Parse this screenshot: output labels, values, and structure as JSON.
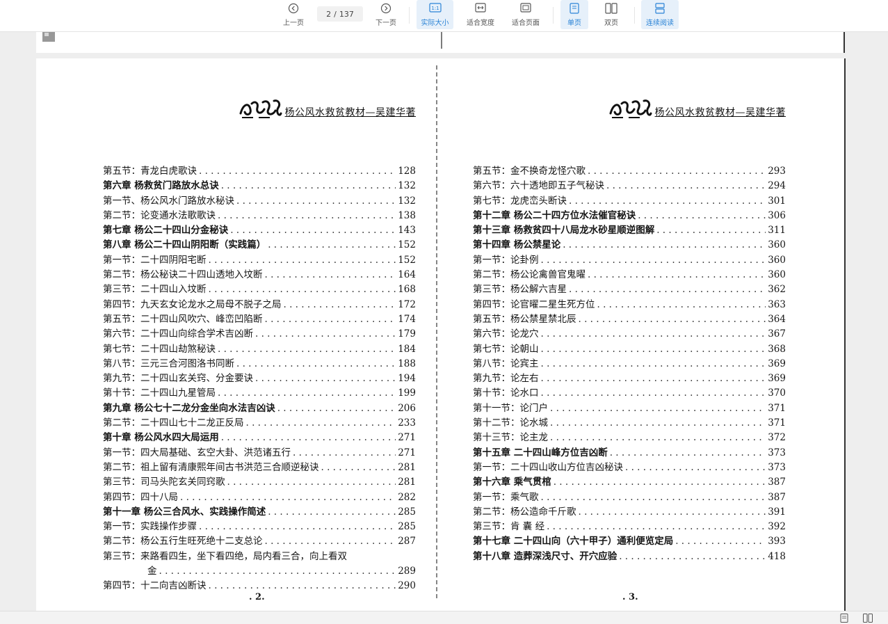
{
  "toolbar": {
    "prev_label": "上一页",
    "next_label": "下一页",
    "current_page": "2",
    "page_separator": "/",
    "total_pages": "137",
    "actual_size_label": "实际大小",
    "fit_width_label": "适合宽度",
    "fit_page_label": "适合页面",
    "single_page_label": "单页",
    "double_page_label": "双页",
    "continuous_label": "连续阅读",
    "accent_color": "#2a83d6",
    "active_bg": "#e6f0fa"
  },
  "left_page": {
    "header_title": "杨公风水救贫教材—吴建华著",
    "page_number": ". 2.",
    "entries": [
      {
        "title": "第五节：青龙白虎歌诀",
        "page": "128",
        "chapter": false
      },
      {
        "title": "第六章  杨救贫门路放水总诀",
        "page": "132",
        "chapter": true
      },
      {
        "title": "第一节、杨公风水门路放水秘诀",
        "page": "132",
        "chapter": false
      },
      {
        "title": "第二节：论变通水法歌歌诀",
        "page": "138",
        "chapter": false
      },
      {
        "title": "第七章  杨公二十四山分金秘诀",
        "page": "143",
        "chapter": true
      },
      {
        "title": "第八章  杨公二十四山阴阳断（实践篇）",
        "page": "152",
        "chapter": true
      },
      {
        "title": "第一节：二十四阴阳宅断",
        "page": "152",
        "chapter": false
      },
      {
        "title": "第二节：杨公秘诀二十四山透地入坟断",
        "page": "164",
        "chapter": false
      },
      {
        "title": "第三节：二十四山入坟断",
        "page": "168",
        "chapter": false
      },
      {
        "title": "第四节：九天玄女论龙水之局母不脱子之局",
        "page": "172",
        "chapter": false
      },
      {
        "title": "第五节：二十四山风吹穴、峰峦凹陷断",
        "page": "174",
        "chapter": false
      },
      {
        "title": "第六节：二十四山向综合学术吉凶断",
        "page": "179",
        "chapter": false
      },
      {
        "title": "第七节：二十四山劫煞秘诀",
        "page": "184",
        "chapter": false
      },
      {
        "title": "第八节：三元三合河图洛书同断",
        "page": "188",
        "chapter": false
      },
      {
        "title": "第九节：二十四山玄关窍、分金要诀",
        "page": "194",
        "chapter": false
      },
      {
        "title": "第十节：二十四山九星管局",
        "page": "199",
        "chapter": false
      },
      {
        "title": "第九章  杨公七十二龙分金坐向水法吉凶诀",
        "page": "206",
        "chapter": true
      },
      {
        "title": "第二节：二十四山七十二龙正反局",
        "page": "233",
        "chapter": false
      },
      {
        "title": "第十章  杨公风水四大局运用",
        "page": "271",
        "chapter": true
      },
      {
        "title": "第一节：四大局基础、玄空大卦、洪范诸五行",
        "page": "271",
        "chapter": false
      },
      {
        "title": "第二节：祖上留有清康熙年间古书洪范三合顺逆秘诀",
        "page": "281",
        "chapter": false
      },
      {
        "title": "第三节：司马头陀玄关同窍歌",
        "page": "281",
        "chapter": false
      },
      {
        "title": "第四节：四十八局",
        "page": "282",
        "chapter": false
      },
      {
        "title": "第十一章  杨公三合风水、实践操作简述",
        "page": "285",
        "chapter": true
      },
      {
        "title": "第一节：实践操作步骤",
        "page": "285",
        "chapter": false
      },
      {
        "title": "第二节：杨公五行生旺死绝十二支总论",
        "page": "287",
        "chapter": false
      },
      {
        "title": "第三节：来路看四生，坐下看四绝，局内看三合，向上看双",
        "page": "",
        "chapter": false
      },
      {
        "title": "金",
        "page": "289",
        "chapter": false,
        "continuation": true
      },
      {
        "title": "第四节：十二向吉凶断诀",
        "page": "290",
        "chapter": false
      }
    ]
  },
  "right_page": {
    "header_title": "杨公风水救贫教材—吴建华著",
    "page_number": ". 3.",
    "entries": [
      {
        "title": "第五节：金不换奇龙怪穴歌",
        "page": "293",
        "chapter": false
      },
      {
        "title": "第六节：六十透地即五子气秘诀",
        "page": "294",
        "chapter": false
      },
      {
        "title": "第七节：龙虎峦头断诀",
        "page": "301",
        "chapter": false
      },
      {
        "title": "第十二章  杨公二十四方位水法催官秘诀",
        "page": "306",
        "chapter": true
      },
      {
        "title": "第十三章    杨救贫四十八局龙水砂星顺逆图解",
        "page": "311",
        "chapter": true
      },
      {
        "title": "第十四章  杨公禁星论",
        "page": "360",
        "chapter": true
      },
      {
        "title": "第一节：论卦例",
        "page": "360",
        "chapter": false
      },
      {
        "title": "第二节：杨公论禽兽官鬼曜",
        "page": "360",
        "chapter": false
      },
      {
        "title": "第三节：杨公解六吉星",
        "page": "362",
        "chapter": false
      },
      {
        "title": "第四节：论官曜二星生死方位",
        "page": "363",
        "chapter": false
      },
      {
        "title": "第五节：杨公禁星禁北辰",
        "page": "364",
        "chapter": false
      },
      {
        "title": "第六节：论龙穴",
        "page": "367",
        "chapter": false
      },
      {
        "title": "第七节：论朝山",
        "page": "368",
        "chapter": false
      },
      {
        "title": "第八节：论宾主",
        "page": "369",
        "chapter": false
      },
      {
        "title": "第九节：论左右",
        "page": "369",
        "chapter": false
      },
      {
        "title": "第十节：论水口",
        "page": "370",
        "chapter": false
      },
      {
        "title": "第十一节：论门户",
        "page": "371",
        "chapter": false
      },
      {
        "title": "第十二节：论水城",
        "page": "371",
        "chapter": false
      },
      {
        "title": "第十三节：论主龙",
        "page": "372",
        "chapter": false
      },
      {
        "title": "第十五章  二十四山峰方位吉凶断",
        "page": "373",
        "chapter": true
      },
      {
        "title": "第一节：二十四山收山方位吉凶秘诀",
        "page": "373",
        "chapter": false
      },
      {
        "title": "第十六章  乘气贯棺",
        "page": "387",
        "chapter": true
      },
      {
        "title": "第一节：乘气歌",
        "page": "387",
        "chapter": false
      },
      {
        "title": "第二节：杨公造命千斤歌",
        "page": "391",
        "chapter": false
      },
      {
        "title": "第三节：肯 囊 经",
        "page": "392",
        "chapter": false
      },
      {
        "title": "第十七章 二十四山向（六十甲子）通利便览定局",
        "page": "393",
        "chapter": true
      },
      {
        "title": "第十八章  造葬深浅尺寸、开穴应验",
        "page": "418",
        "chapter": true
      }
    ]
  },
  "statusbar": {
    "single_icon": "single-page-icon",
    "double_icon": "double-page-icon"
  }
}
